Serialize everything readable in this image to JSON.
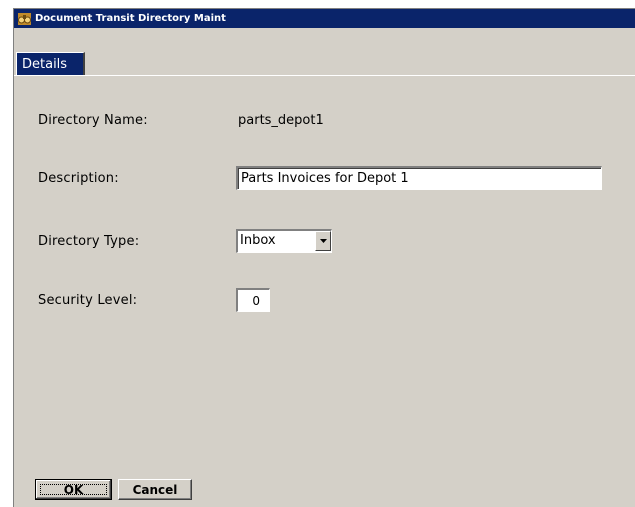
{
  "window": {
    "title": "Document Transit Directory Maint",
    "app_icon": "binoculars-icon"
  },
  "tabs": [
    {
      "label": "Details",
      "selected": true
    }
  ],
  "form": {
    "directory_name": {
      "label": "Directory Name:",
      "value": "parts_depot1"
    },
    "description": {
      "label": "Description:",
      "value": "Parts Invoices for Depot 1"
    },
    "directory_type": {
      "label": "Directory Type:",
      "value": "Inbox"
    },
    "security_level": {
      "label": "Security Level:",
      "value": "0"
    }
  },
  "buttons": {
    "ok_label": "OK",
    "cancel_label": "Cancel"
  },
  "colors": {
    "titlebar": "#0a246a",
    "face": "#d4d0c8",
    "tab_selected": "#0a246a"
  }
}
